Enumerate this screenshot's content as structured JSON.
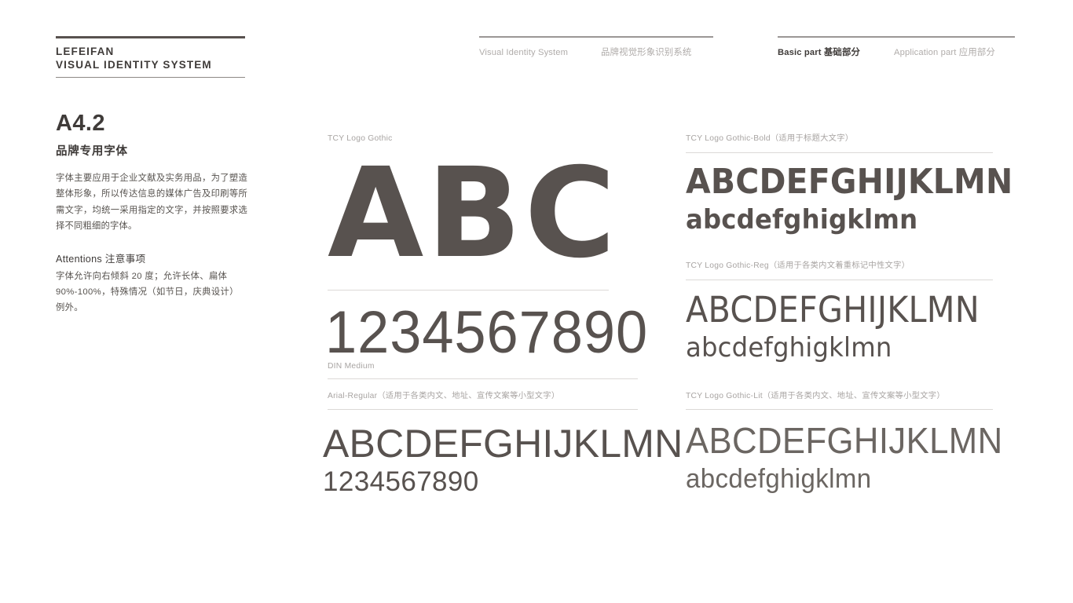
{
  "header": {
    "brand_name": "LEFEIFAN",
    "brand_subtitle": "VISUAL IDENTITY SYSTEM",
    "nav": {
      "vis_en": "Visual Identity System",
      "vis_cn": "品牌视觉形象识别系统",
      "basic_en": "Basic part",
      "basic_cn": "基础部分",
      "application_en": "Application part",
      "application_cn": "应用部分"
    }
  },
  "sidebar": {
    "section_code": "A4.2",
    "section_title_cn": "品牌专用字体",
    "description": "字体主要应用于企业文献及实务用品，为了塑造整体形象，所以传达信息的媒体广告及印刷等所需文字，均统一采用指定的文字，并按照要求选择不同粗细的字体。",
    "attentions_heading": "Attentions 注意事项",
    "attentions_body": "字体允许向右倾斜 20 度；允许长体、扁体 90%-100%，特殊情况（如节日，庆典设计）例外。"
  },
  "specimens": {
    "center": [
      {
        "label": "TCY Logo Gothic",
        "sample_upper": "ABC"
      },
      {
        "label": "DIN Medium",
        "sample_digits": "1234567890"
      },
      {
        "label": "Arial-Regular（适用于各类内文、地址、宣传文案等小型文字）",
        "sample_upper": "ABCDEFGHIJKLMN",
        "sample_digits": "1234567890"
      }
    ],
    "right": [
      {
        "label": "TCY Logo Gothic-Bold（适用于标题大文字）",
        "sample_upper": "ABCDEFGHIJKLMN",
        "sample_lower": "abcdefghigklmn"
      },
      {
        "label": "TCY Logo Gothic-Reg（适用于各类内文着重标记中性文字）",
        "sample_upper": "ABCDEFGHIJKLMN",
        "sample_lower": "abcdefghigklmn"
      },
      {
        "label": "TCY Logo Gothic-Lit（适用于各类内文、地址、宣传文案等小型文字）",
        "sample_upper": "ABCDEFGHIJKLMN",
        "sample_lower": "abcdefghigklmn"
      }
    ]
  },
  "colors": {
    "ink": "#58524f",
    "ink_dark": "#3f3b39",
    "muted": "#a8a4a2",
    "rule": "#dcd9d7",
    "background": "#ffffff"
  }
}
